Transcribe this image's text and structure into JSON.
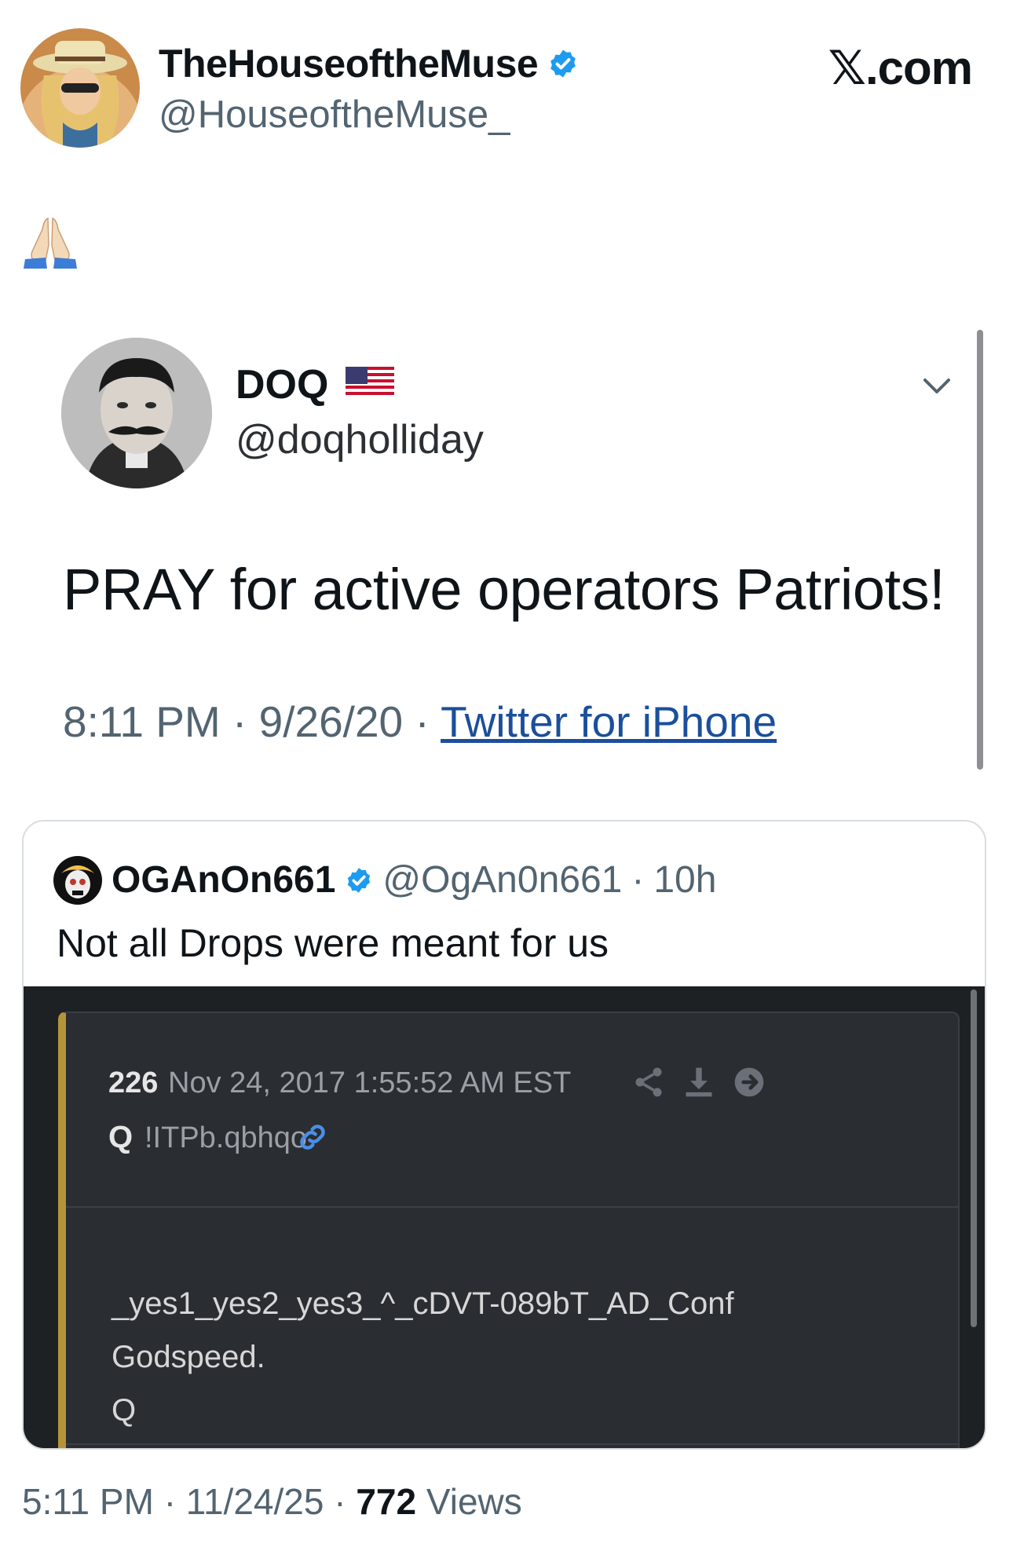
{
  "author": {
    "display_name": "TheHouseoftheMuse",
    "handle": "@HouseoftheMuse_",
    "verified": true
  },
  "brand": "𝕏.com",
  "post_text_emoji": "🙏",
  "embedded_tweet": {
    "display_name": "DOQ",
    "flag": "🇺🇸",
    "handle": "@doqholliday",
    "text": "PRAY for active operators Patriots!",
    "time": "8:11 PM",
    "date": "9/26/20",
    "sep": "·",
    "source": "Twitter for iPhone"
  },
  "quoted_post": {
    "display_name": "OGAnOn661",
    "handle": "@OgAn0n661",
    "sep": "·",
    "age": "10h",
    "text": "Not all Drops were meant for us",
    "drop": {
      "number": "226",
      "date": "Nov 24, 2017 1:55:52 AM EST",
      "author": "Q",
      "tripcode": "!ITPb.qbhqo",
      "body": "_yes1_yes2_yes3_^_cDVT-089bT_AD_Conf\nGodspeed.\nQ"
    }
  },
  "footer": {
    "time": "5:11 PM",
    "date": "11/24/25",
    "sep": "·",
    "views_count": "772",
    "views_label": "Views"
  },
  "colors": {
    "verified": "#1d9bf0",
    "muted_text": "#536471",
    "drop_bg": "#2a2d32",
    "drop_accent": "#b59438",
    "link": "#1b4f9c"
  }
}
